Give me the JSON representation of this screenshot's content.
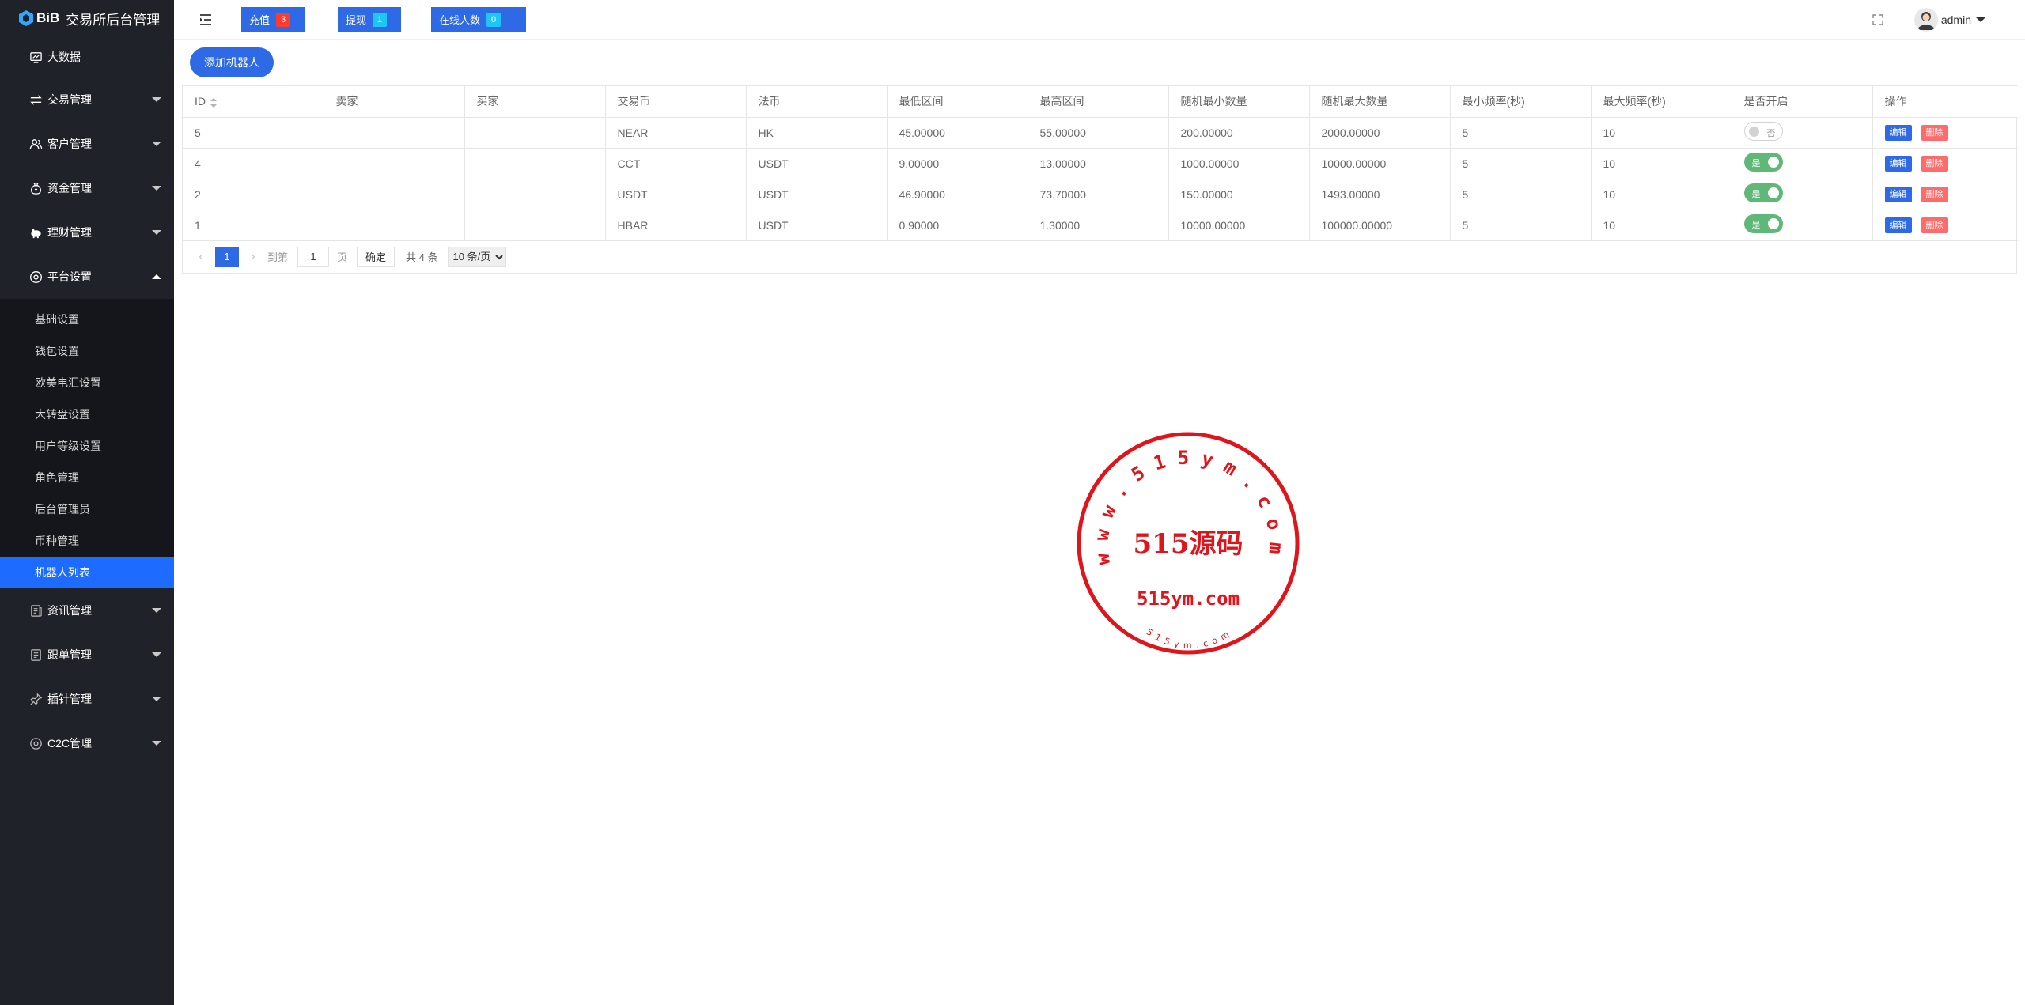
{
  "app": {
    "brand": "BiB",
    "title": "交易所后台管理"
  },
  "colors": {
    "sidebar_bg": "#20222a",
    "accent": "#2f6ae6",
    "active_item": "#1e6bff",
    "switch_on": "#5fb878",
    "delete": "#ff6b6b",
    "stamp_red": "#e0141b"
  },
  "sidebar": {
    "items": [
      {
        "label": "大数据",
        "icon": "monitor-icon"
      },
      {
        "label": "交易管理",
        "icon": "exchange-icon"
      },
      {
        "label": "客户管理",
        "icon": "users-icon"
      },
      {
        "label": "资金管理",
        "icon": "money-bag-icon"
      },
      {
        "label": "理财管理",
        "icon": "piggy-bank-icon"
      },
      {
        "label": "平台设置",
        "icon": "settings-circle-icon"
      }
    ],
    "submenu": [
      {
        "label": "基础设置"
      },
      {
        "label": "钱包设置"
      },
      {
        "label": "欧美电汇设置"
      },
      {
        "label": "大转盘设置"
      },
      {
        "label": "用户等级设置"
      },
      {
        "label": "角色管理"
      },
      {
        "label": "后台管理员"
      },
      {
        "label": "币种管理"
      },
      {
        "label": "机器人列表",
        "active": true
      }
    ],
    "items_after": [
      {
        "label": "资讯管理",
        "icon": "news-icon"
      },
      {
        "label": "跟单管理",
        "icon": "document-icon"
      },
      {
        "label": "插针管理",
        "icon": "pin-icon"
      },
      {
        "label": "C2C管理",
        "icon": "c2c-icon"
      }
    ]
  },
  "topbar": {
    "recharge": {
      "label": "充值",
      "count": "3"
    },
    "withdraw": {
      "label": "提现",
      "count": "1"
    },
    "online": {
      "label": "在线人数",
      "count": "0"
    },
    "user": "admin"
  },
  "main": {
    "add_button": "添加机器人",
    "table": {
      "headers": [
        "ID",
        "卖家",
        "买家",
        "交易币",
        "法币",
        "最低区间",
        "最高区间",
        "随机最小数量",
        "随机最大数量",
        "最小频率(秒)",
        "最大频率(秒)",
        "是否开启",
        "操作"
      ],
      "rows": [
        {
          "id": "5",
          "seller": "",
          "buyer": "",
          "coin": "NEAR",
          "fiat": "HK",
          "min_range": "45.00000",
          "max_range": "55.00000",
          "min_qty": "200.00000",
          "max_qty": "2000.00000",
          "min_freq": "5",
          "max_freq": "10",
          "enabled": false,
          "switch_label": "否"
        },
        {
          "id": "4",
          "seller": "",
          "buyer": "",
          "coin": "CCT",
          "fiat": "USDT",
          "min_range": "9.00000",
          "max_range": "13.00000",
          "min_qty": "1000.00000",
          "max_qty": "10000.00000",
          "min_freq": "5",
          "max_freq": "10",
          "enabled": true,
          "switch_label": "是"
        },
        {
          "id": "2",
          "seller": "",
          "buyer": "",
          "coin": "USDT",
          "fiat": "USDT",
          "min_range": "46.90000",
          "max_range": "73.70000",
          "min_qty": "150.00000",
          "max_qty": "1493.00000",
          "min_freq": "5",
          "max_freq": "10",
          "enabled": true,
          "switch_label": "是"
        },
        {
          "id": "1",
          "seller": "",
          "buyer": "",
          "coin": "HBAR",
          "fiat": "USDT",
          "min_range": "0.90000",
          "max_range": "1.30000",
          "min_qty": "10000.00000",
          "max_qty": "100000.00000",
          "min_freq": "5",
          "max_freq": "10",
          "enabled": true,
          "switch_label": "是"
        }
      ],
      "edit_label": "编辑",
      "delete_label": "删除"
    },
    "pager": {
      "prev": "‹",
      "current": "1",
      "next": "›",
      "goto_label": "到第",
      "goto_value": "1",
      "page_label": "页",
      "confirm": "确定",
      "total": "共 4 条",
      "page_size": "10 条/页"
    }
  },
  "watermark": {
    "top_arc": "www.515ym.com",
    "center": "515源码",
    "lower": "515ym.com",
    "bottom_arc": "515ym.com"
  }
}
